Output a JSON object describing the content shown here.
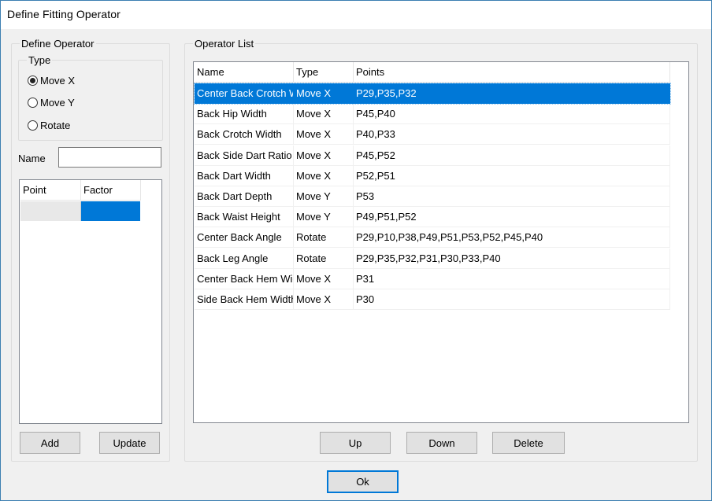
{
  "window": {
    "title": "Define Fitting Operator"
  },
  "define_operator": {
    "group_label": "Define Operator",
    "type_label": "Type",
    "types": [
      {
        "label": "Move X",
        "checked": true
      },
      {
        "label": "Move Y",
        "checked": false
      },
      {
        "label": "Rotate",
        "checked": false
      }
    ],
    "name_label": "Name",
    "name_value": "",
    "point_table": {
      "columns": [
        "Point",
        "Factor"
      ]
    },
    "add_label": "Add",
    "update_label": "Update"
  },
  "operator_list": {
    "group_label": "Operator List",
    "columns": [
      "Name",
      "Type",
      "Points"
    ],
    "rows": [
      {
        "name": "Center Back Crotch Width",
        "type": "Move X",
        "points": "P29,P35,P32",
        "selected": true
      },
      {
        "name": "Back Hip Width",
        "type": "Move X",
        "points": "P45,P40"
      },
      {
        "name": "Back Crotch Width",
        "type": "Move X",
        "points": "P40,P33"
      },
      {
        "name": "Back Side Dart Ratio",
        "type": "Move X",
        "points": "P45,P52"
      },
      {
        "name": "Back Dart Width",
        "type": "Move X",
        "points": "P52,P51"
      },
      {
        "name": "Back Dart Depth",
        "type": "Move Y",
        "points": "P53"
      },
      {
        "name": "Back Waist Height",
        "type": "Move Y",
        "points": "P49,P51,P52"
      },
      {
        "name": "Center Back Angle",
        "type": "Rotate",
        "points": "P29,P10,P38,P49,P51,P53,P52,P45,P40"
      },
      {
        "name": "Back Leg Angle",
        "type": "Rotate",
        "points": "P29,P35,P32,P31,P30,P33,P40"
      },
      {
        "name": "Center Back Hem Width",
        "type": "Move X",
        "points": "P31"
      },
      {
        "name": "Side Back Hem Width",
        "type": "Move X",
        "points": "P30"
      }
    ],
    "up_label": "Up",
    "down_label": "Down",
    "delete_label": "Delete"
  },
  "ok_label": "Ok"
}
